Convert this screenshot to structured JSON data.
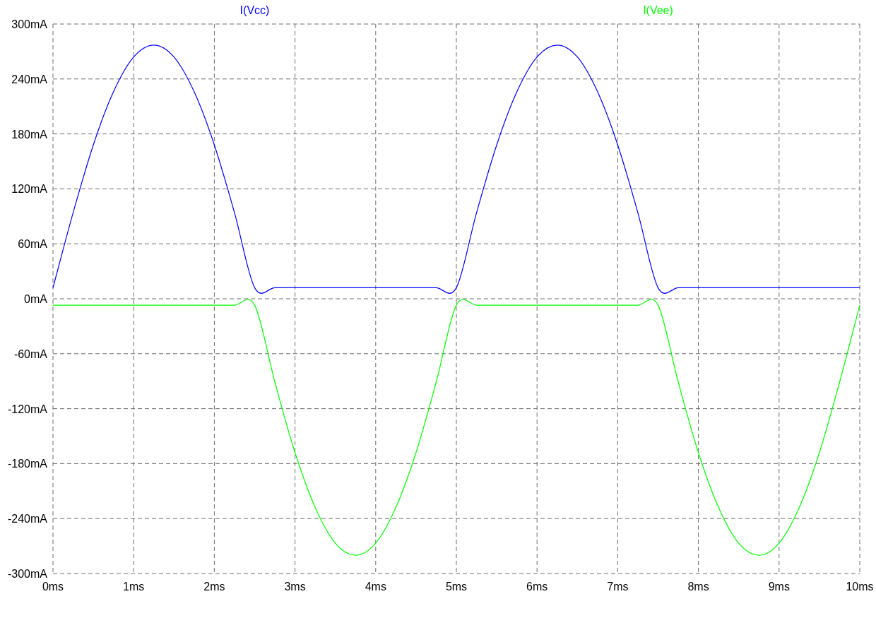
{
  "chart_data": {
    "type": "line",
    "grid": true,
    "x": [
      0,
      0.25,
      0.5,
      0.75,
      1,
      1.25,
      1.5,
      1.75,
      2,
      2.25,
      2.5,
      2.75,
      3,
      3.25,
      3.5,
      3.75,
      4,
      4.25,
      4.5,
      4.75,
      5,
      5.25,
      5.5,
      5.75,
      6,
      6.25,
      6.5,
      6.75,
      7,
      7.25,
      7.5,
      7.75,
      8,
      8.25,
      8.5,
      8.75,
      9,
      9.25,
      9.5,
      9.75,
      10
    ],
    "series": [
      {
        "name": "I(Vcc)",
        "color": "#0000ff",
        "values": [
          12,
          94,
          168,
          226,
          264,
          277,
          264,
          226,
          168,
          94,
          12,
          12,
          12,
          12,
          12,
          12,
          12,
          12,
          12,
          12,
          12,
          94,
          168,
          226,
          264,
          277,
          264,
          226,
          168,
          94,
          12,
          12,
          12,
          12,
          12,
          12,
          12,
          12,
          12,
          12,
          12
        ]
      },
      {
        "name": "I(Vee)",
        "color": "#00ff00",
        "values": [
          -7,
          -7,
          -7,
          -7,
          -7,
          -7,
          -7,
          -7,
          -7,
          -7,
          -7,
          -91,
          -168,
          -228,
          -267,
          -280,
          -267,
          -228,
          -168,
          -91,
          -7,
          -7,
          -7,
          -7,
          -7,
          -7,
          -7,
          -7,
          -7,
          -7,
          -7,
          -91,
          -168,
          -228,
          -267,
          -280,
          -267,
          -228,
          -168,
          -91,
          -7
        ]
      }
    ],
    "xlim": [
      0,
      10
    ],
    "ylim": [
      -300,
      300
    ],
    "xticks": [
      {
        "value": 0,
        "label": "0ms"
      },
      {
        "value": 1,
        "label": "1ms"
      },
      {
        "value": 2,
        "label": "2ms"
      },
      {
        "value": 3,
        "label": "3ms"
      },
      {
        "value": 4,
        "label": "4ms"
      },
      {
        "value": 5,
        "label": "5ms"
      },
      {
        "value": 6,
        "label": "6ms"
      },
      {
        "value": 7,
        "label": "7ms"
      },
      {
        "value": 8,
        "label": "8ms"
      },
      {
        "value": 9,
        "label": "9ms"
      },
      {
        "value": 10,
        "label": "10ms"
      }
    ],
    "yticks": [
      {
        "value": 300,
        "label": "300mA"
      },
      {
        "value": 240,
        "label": "240mA"
      },
      {
        "value": 180,
        "label": "180mA"
      },
      {
        "value": 120,
        "label": "120mA"
      },
      {
        "value": 60,
        "label": "60mA"
      },
      {
        "value": 0,
        "label": "0mA"
      },
      {
        "value": -60,
        "label": "-60mA"
      },
      {
        "value": -120,
        "label": "-120mA"
      },
      {
        "value": -180,
        "label": "-180mA"
      },
      {
        "value": -240,
        "label": "-240mA"
      },
      {
        "value": -300,
        "label": "-300mA"
      }
    ]
  }
}
